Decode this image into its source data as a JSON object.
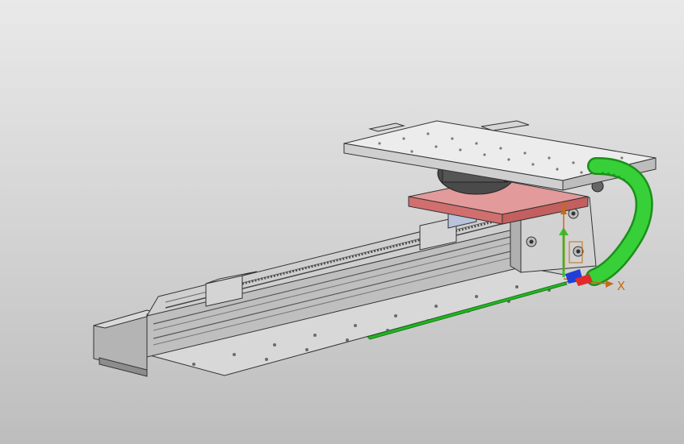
{
  "viewport": {
    "background_top": "#e9e9e9",
    "background_bottom": "#bdbdbd"
  },
  "model": {
    "parts": [
      "linear-actuator-rail",
      "motor-block",
      "carriage-plate",
      "top-mounting-plate",
      "rotary-gripper-unit",
      "drag-chain",
      "end-cap",
      "base-strip"
    ],
    "colors": {
      "rail": "#c9c9c9",
      "rail_dark": "#8f8f8f",
      "carriage_plate": "#e08282",
      "drag_chain": "#2ec52e",
      "gripper_body": "#4a4a4a",
      "top_plate": "#e6e6e6",
      "base_strip": "#22b522"
    }
  },
  "triad": {
    "x_label": "X",
    "y_label": "Y",
    "x_color": "#c46d14",
    "y_color": "#c46d14",
    "z_color": "#1f3fd8"
  }
}
